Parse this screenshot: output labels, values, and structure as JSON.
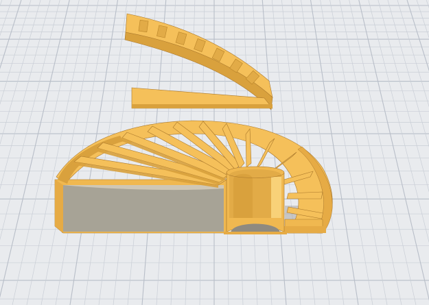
{
  "viewport": {
    "background": "#e9ebee",
    "grid_color": "#c9ced6",
    "grid_major_color": "#b8bec8"
  },
  "model": {
    "fill": "#f5c05a",
    "highlight": "#f8d178",
    "shadow": "#d9a13d",
    "deep_shadow": "#b98428",
    "edge": "#a8762a",
    "parts": [
      "curved-ramp-part",
      "flat-bar-part",
      "half-disc-base-part"
    ]
  }
}
